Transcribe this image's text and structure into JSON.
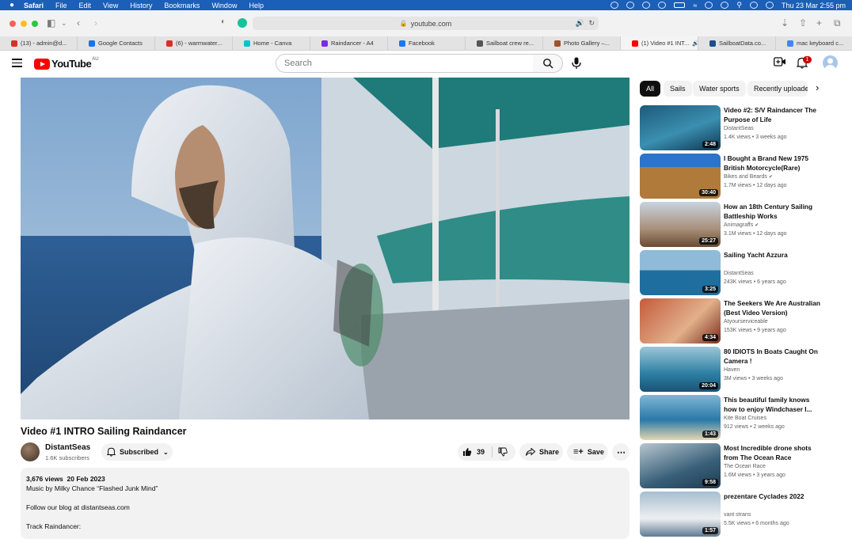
{
  "menubar": {
    "app": "Safari",
    "items": [
      "File",
      "Edit",
      "View",
      "History",
      "Bookmarks",
      "Window",
      "Help"
    ],
    "clock": "Thu 23 Mar  2:55 pm"
  },
  "browser": {
    "url": "youtube.com",
    "tabs": [
      {
        "label": "(13) - admin@d...",
        "color": "#d93025"
      },
      {
        "label": "Google Contacts",
        "color": "#1a73e8"
      },
      {
        "label": "(6) - warmwater...",
        "color": "#d93025"
      },
      {
        "label": "Home - Canva",
        "color": "#00c4cc"
      },
      {
        "label": "Raindancer - A4",
        "color": "#7d2ae8"
      },
      {
        "label": "Facebook",
        "color": "#1877f2"
      },
      {
        "label": "Sailboat crew re...",
        "color": "#555555"
      },
      {
        "label": "Photo Gallery –...",
        "color": "#a0522d"
      },
      {
        "label": "(1) Video #1 INT...",
        "color": "#ff0000"
      },
      {
        "label": "SailboatData.co...",
        "color": "#1a4f8b"
      },
      {
        "label": "mac keyboard c...",
        "color": "#4285f4"
      }
    ]
  },
  "header": {
    "logo_text": "YouTube",
    "country": "AU",
    "search_placeholder": "Search",
    "notifications": "1"
  },
  "video": {
    "title": "Video #1 INTRO Sailing Raindancer",
    "channel": "DistantSeas",
    "subscribers": "1.6K subscribers",
    "subscribe_label": "Subscribed",
    "likes": "39",
    "share_label": "Share",
    "save_label": "Save",
    "description": {
      "views": "3,676 views",
      "date": "20 Feb 2023",
      "line1": "Music by Milky Chance “Flashed Junk Mind”",
      "line2": "Follow our blog at distantseas.com",
      "line3": "Track Raindancer:"
    }
  },
  "chips": [
    "All",
    "Sails",
    "Water sports",
    "Recently uploaded"
  ],
  "recommendations": [
    {
      "title": "Video #2: S/V Raindancer The Purpose of Life",
      "channel": "DistantSeas",
      "views": "1.4K views",
      "age": "3 weeks ago",
      "duration": "2:48",
      "verified": false
    },
    {
      "title": "I Bought a Brand New 1975 British Motorcycle(Rare)",
      "channel": "Bikes and Beards",
      "views": "1.7M views",
      "age": "12 days ago",
      "duration": "30:40",
      "verified": true
    },
    {
      "title": "How an 18th Century Sailing Battleship Works",
      "channel": "Animagraffs",
      "views": "3.1M views",
      "age": "12 days ago",
      "duration": "25:27",
      "verified": true
    },
    {
      "title": "Sailing Yacht Azzura",
      "channel": "DistantSeas",
      "views": "243K views",
      "age": "6 years ago",
      "duration": "3:25",
      "verified": false
    },
    {
      "title": "The Seekers We Are Australian (Best Video Version)",
      "channel": "Atyourserviceable",
      "views": "153K views",
      "age": "9 years ago",
      "duration": "4:34",
      "verified": false
    },
    {
      "title": "80 IDIOTS In Boats Caught On Camera !",
      "channel": "Haven",
      "views": "3M views",
      "age": "3 weeks ago",
      "duration": "20:04",
      "verified": false
    },
    {
      "title": "This beautiful family knows how to enjoy Windchaser I...",
      "channel": "Kite Boat Cruises",
      "views": "912 views",
      "age": "2 weeks ago",
      "duration": "1:43",
      "verified": false
    },
    {
      "title": "Most Incredible drone shots from The Ocean Race",
      "channel": "The Ocean Race",
      "views": "1.6M views",
      "age": "3 years ago",
      "duration": "9:58",
      "verified": false
    },
    {
      "title": "prezentare Cyclades 2022",
      "channel": "vant strans",
      "views": "5.5K views",
      "age": "6 months ago",
      "duration": "1:57",
      "verified": false
    }
  ]
}
